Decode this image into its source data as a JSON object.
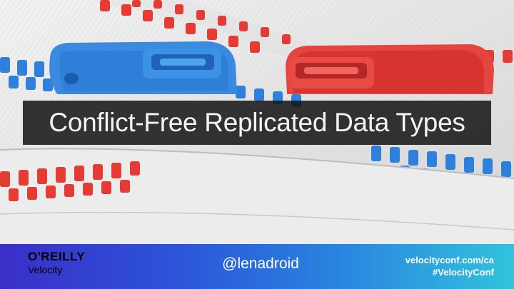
{
  "slide": {
    "title": "Conflict-Free Replicated Data Types",
    "background_image": "zipper-icon"
  },
  "footer": {
    "brand": "O'REILLY",
    "product": "Velocity",
    "handle": "@lenadroid",
    "website": "velocityconf.com/ca",
    "hashtag": "#VelocityConf"
  },
  "colors": {
    "zipper_blue": "#2f7fd8",
    "zipper_red": "#e23a36",
    "fabric": "#e9e9e9",
    "title_band": "#141416",
    "footer_start": "#3a2fc9",
    "footer_end": "#31c3dd"
  }
}
